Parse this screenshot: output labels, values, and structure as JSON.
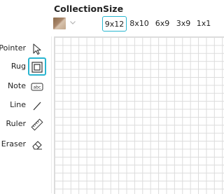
{
  "header": {
    "collection_label": "Collection",
    "size_label": "Size"
  },
  "collection": {
    "selected_swatch_icon": "wood-swatch",
    "dropdown_icon": "chevron-down-icon"
  },
  "sizes": [
    {
      "label": "9x12",
      "selected": true
    },
    {
      "label": "8x10",
      "selected": false
    },
    {
      "label": "6x9",
      "selected": false
    },
    {
      "label": "3x9",
      "selected": false
    },
    {
      "label": "1x1",
      "selected": false
    }
  ],
  "tools": [
    {
      "label": "Pointer",
      "icon": "pointer-icon",
      "selected": false
    },
    {
      "label": "Rug",
      "icon": "rug-icon",
      "selected": true
    },
    {
      "label": "Note",
      "icon": "note-icon",
      "icon_text": "abc",
      "selected": false
    },
    {
      "label": "Line",
      "icon": "line-icon",
      "selected": false
    },
    {
      "label": "Ruler",
      "icon": "ruler-icon",
      "selected": false
    },
    {
      "label": "Eraser",
      "icon": "eraser-icon",
      "selected": false
    }
  ],
  "colors": {
    "accent": "#29b5d0",
    "grid_line": "#dcdcdc"
  }
}
